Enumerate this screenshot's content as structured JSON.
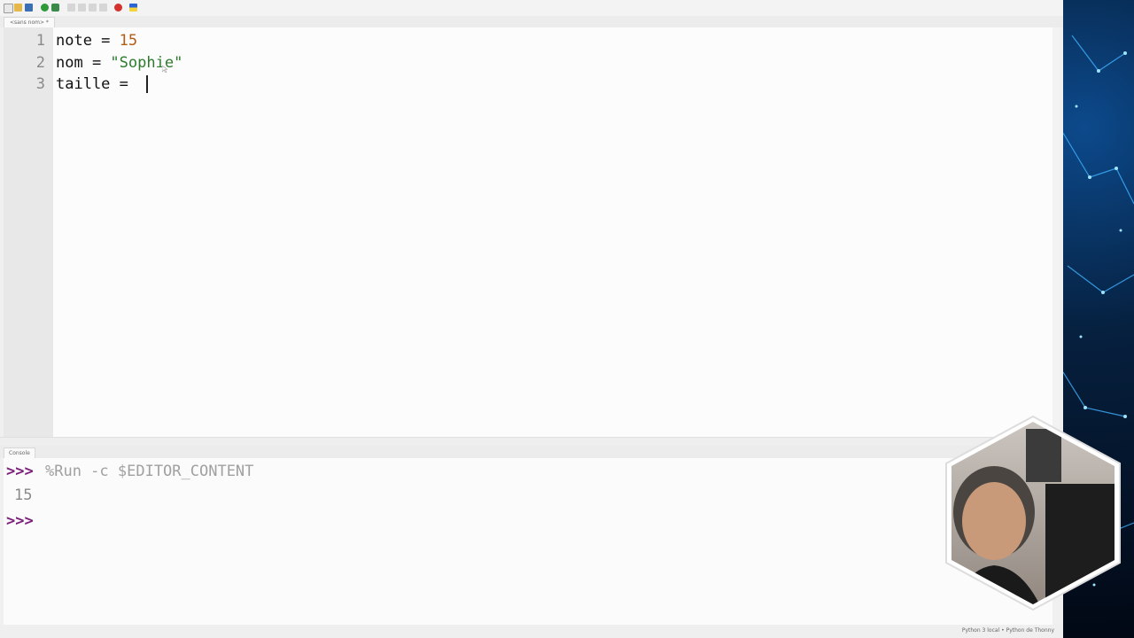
{
  "editor": {
    "tab_label": "<sans nom> *",
    "lines": [
      {
        "number": "1",
        "tokens": [
          {
            "text": "note = ",
            "kind": "plain"
          },
          {
            "text": "15",
            "kind": "number"
          }
        ]
      },
      {
        "number": "2",
        "tokens": [
          {
            "text": "nom = ",
            "kind": "plain"
          },
          {
            "text": "\"Sophie\"",
            "kind": "string"
          }
        ]
      },
      {
        "number": "3",
        "tokens": [
          {
            "text": "taille = ",
            "kind": "plain"
          }
        ]
      }
    ]
  },
  "console": {
    "tab_label": "Console",
    "prompt": ">>>",
    "command": "%Run -c $EDITOR_CONTENT",
    "output": "15"
  },
  "statusbar": {
    "text": "Python 3 local • Python de Thonny"
  },
  "colors": {
    "number": "#b35d14",
    "string": "#2d7a2d",
    "prompt": "#7a1f7a",
    "magic_command": "#a0a0a0"
  },
  "icons": [
    "new-file-icon",
    "open-file-icon",
    "save-icon",
    "run-icon",
    "debug-icon",
    "step-over-icon",
    "step-into-icon",
    "step-out-icon",
    "resume-icon",
    "stop-icon",
    "support-ukraine-icon"
  ]
}
